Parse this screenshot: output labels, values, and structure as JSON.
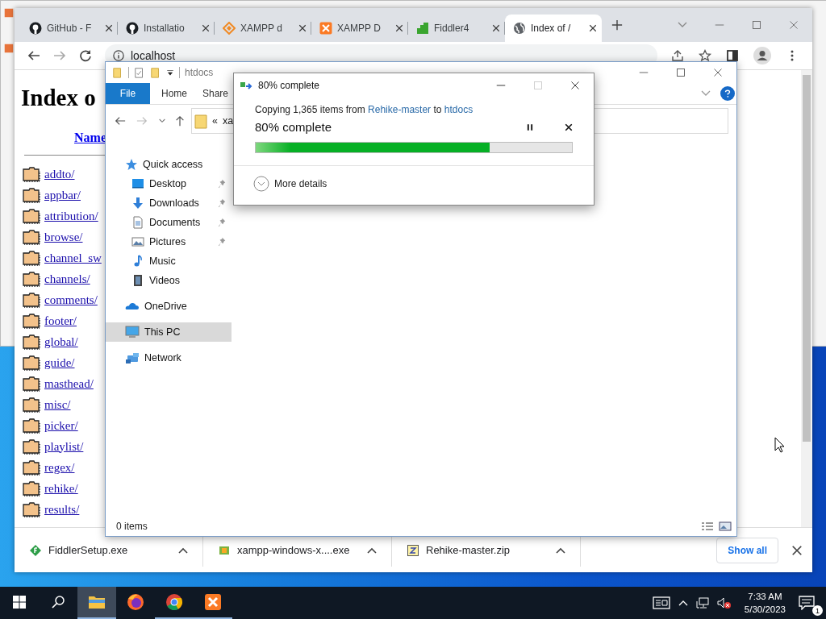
{
  "browser": {
    "tabs": [
      {
        "label": "GitHub - F",
        "kind": "github",
        "selected": false
      },
      {
        "label": "Installatio",
        "kind": "github",
        "selected": false
      },
      {
        "label": "XAMPP d",
        "kind": "diamond",
        "selected": false
      },
      {
        "label": "XAMPP D",
        "kind": "xampp",
        "selected": false
      },
      {
        "label": "Fiddler4",
        "kind": "fiddler",
        "selected": false
      },
      {
        "label": "Index of /",
        "kind": "globe",
        "selected": true
      }
    ],
    "address": "localhost",
    "page": {
      "heading": "Index o",
      "column_header": "Name",
      "entries": [
        "addto/",
        "appbar/",
        "attribution/",
        "browse/",
        "channel_sw",
        "channels/",
        "comments/",
        "footer/",
        "global/",
        "guide/",
        "masthead/",
        "misc/",
        "picker/",
        "playlist/",
        "regex/",
        "rehike/",
        "results/"
      ]
    },
    "downloads": [
      {
        "file": "FiddlerSetup.exe",
        "kind": "fiddler"
      },
      {
        "file": "xampp-windows-x....exe",
        "kind": "xampp"
      },
      {
        "file": "Rehike-master.zip",
        "kind": "zip"
      }
    ],
    "show_all": "Show all"
  },
  "explorer": {
    "title": "htdocs",
    "ribbon_tabs": [
      {
        "label": "File",
        "selected": true
      },
      {
        "label": "Home",
        "selected": false
      },
      {
        "label": "Share",
        "selected": false
      }
    ],
    "address": [
      "«",
      "xa"
    ],
    "nav": [
      {
        "label": "Quick access",
        "kind": "star",
        "selected": false,
        "children": [
          {
            "label": "Desktop",
            "kind": "desktop",
            "pinned": true,
            "selected": false
          },
          {
            "label": "Downloads",
            "kind": "download",
            "pinned": true,
            "selected": false
          },
          {
            "label": "Documents",
            "kind": "document",
            "pinned": true,
            "selected": false
          },
          {
            "label": "Pictures",
            "kind": "pictures",
            "pinned": true,
            "selected": false
          },
          {
            "label": "Music",
            "kind": "music",
            "pinned": false,
            "selected": false
          },
          {
            "label": "Videos",
            "kind": "video",
            "pinned": false,
            "selected": false
          }
        ]
      },
      {
        "label": "OneDrive",
        "kind": "cloud",
        "selected": false
      },
      {
        "label": "This PC",
        "kind": "pc",
        "selected": true
      },
      {
        "label": "Network",
        "kind": "network",
        "selected": false
      }
    ],
    "status": "0 items"
  },
  "dialog": {
    "title": "80% complete",
    "message": {
      "prefix": "Copying 1,365 items from",
      "source": "Rehike-master",
      "joiner": "to",
      "destination": "htdocs"
    },
    "heading": "80% complete",
    "level": 0.74,
    "details": "More details"
  },
  "taskbar": {
    "apps": [
      {
        "kind": "explorer",
        "running": true,
        "active": true
      },
      {
        "kind": "firefox",
        "running": false,
        "active": false
      },
      {
        "kind": "chrome",
        "running": true,
        "active": false
      },
      {
        "kind": "xampp",
        "running": true,
        "active": false
      }
    ],
    "time": "7:33 AM",
    "date": "5/30/2023",
    "notifications": "1"
  }
}
